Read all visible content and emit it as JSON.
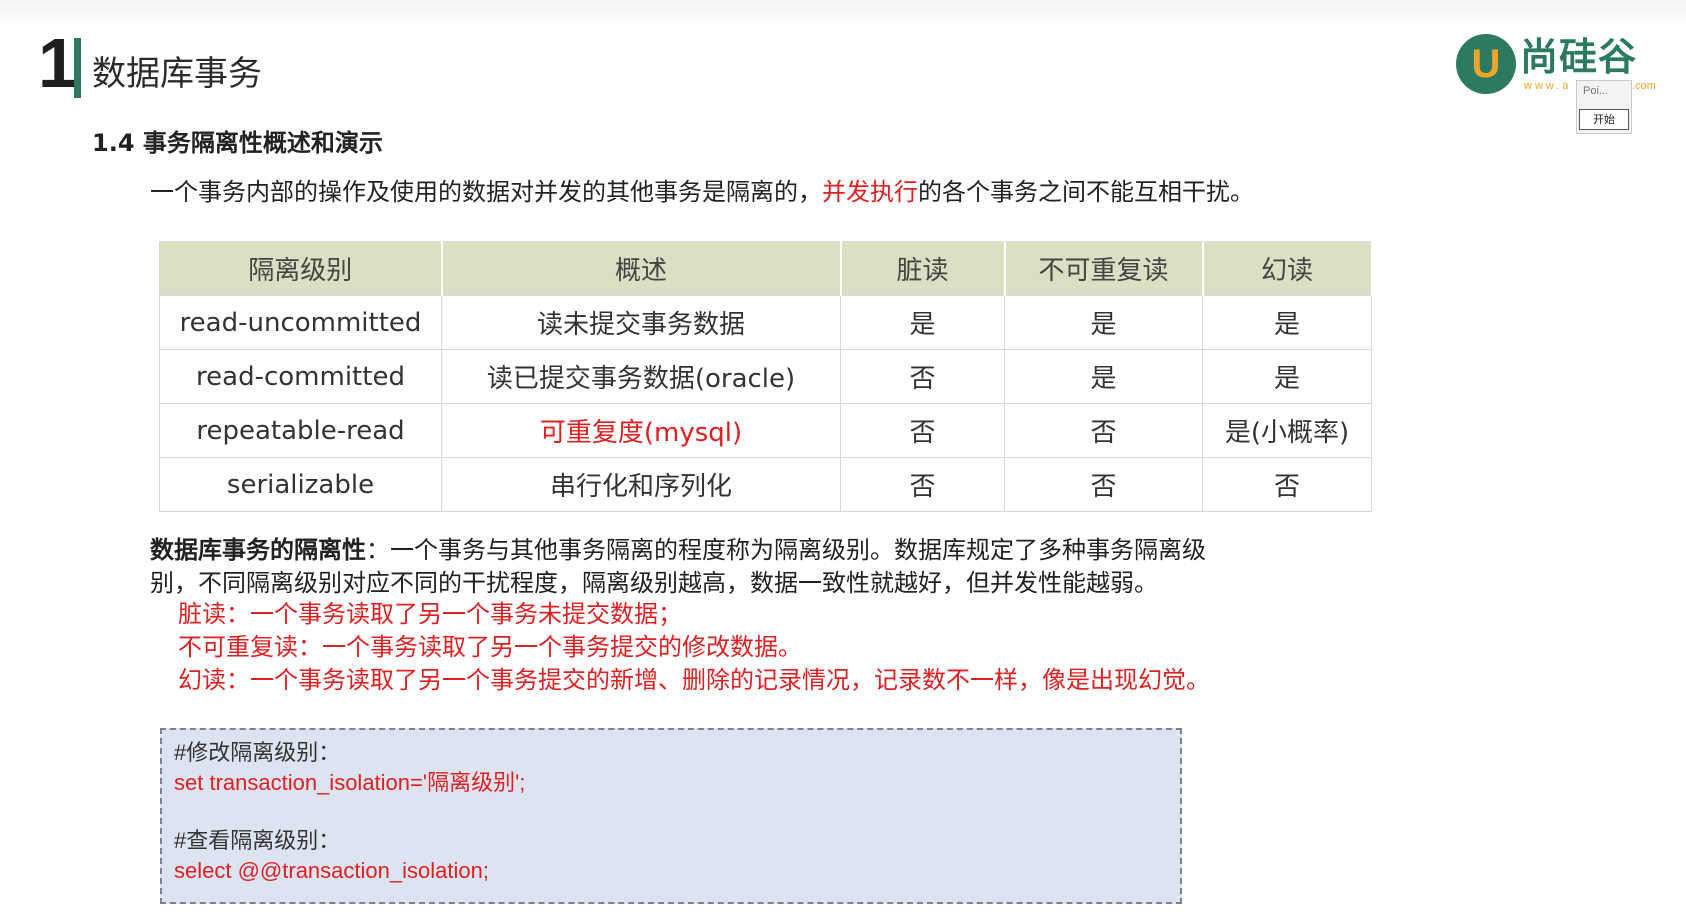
{
  "header": {
    "chapter_number": "1",
    "chapter_title": "数据库事务"
  },
  "logo": {
    "mark": "U",
    "name": "尚硅谷",
    "url_left": "www.a",
    "url_right": ".com"
  },
  "mini_widget": {
    "label": "Poi...",
    "button": "开始"
  },
  "heading": "1.4 事务隔离性概述和演示",
  "intro": {
    "part1": "一个事务内部的操作及使用的数据对并发的其他事务是隔离的，",
    "highlight": "并发执行",
    "part2": "的各个事务之间不能互相干扰。"
  },
  "table": {
    "headers": [
      "隔离级别",
      "概述",
      "脏读",
      "不可重复读",
      "幻读"
    ],
    "rows": [
      [
        "read-uncommitted",
        "读未提交事务数据",
        "是",
        "是",
        "是"
      ],
      [
        "read-committed",
        "读已提交事务数据(oracle)",
        "否",
        "是",
        "是"
      ],
      [
        "repeatable-read",
        "可重复度(mysql)",
        "否",
        "否",
        "是(小概率)"
      ],
      [
        "serializable",
        "串行化和序列化",
        "否",
        "否",
        "否"
      ]
    ]
  },
  "paragraph": {
    "bold_lead": "数据库事务的隔离性",
    "line1": "：一个事务与其他事务隔离的程度称为隔离级别。数据库规定了多种事务隔离级",
    "line2": "别，不同隔离级别对应不同的干扰程度，隔离级别越高，数据一致性就越好，但并发性能越弱。"
  },
  "definitions": [
    "脏读：一个事务读取了另一个事务未提交数据；",
    "不可重复读：一个事务读取了另一个事务提交的修改数据。",
    "幻读：一个事务读取了另一个事务提交的新增、删除的记录情况，记录数不一样，像是出现幻觉。"
  ],
  "code": {
    "comment1": "#修改隔离级别：",
    "line1": "set transaction_isolation='隔离级别';",
    "comment2": "#查看隔离级别：",
    "line2": "select @@transaction_isolation;"
  },
  "colors": {
    "accent_green": "#2d7a63",
    "logo_orange": "#f1a629",
    "highlight_red": "#e02020",
    "table_header_bg": "#dcdfc3",
    "code_bg": "#dce3f1"
  }
}
